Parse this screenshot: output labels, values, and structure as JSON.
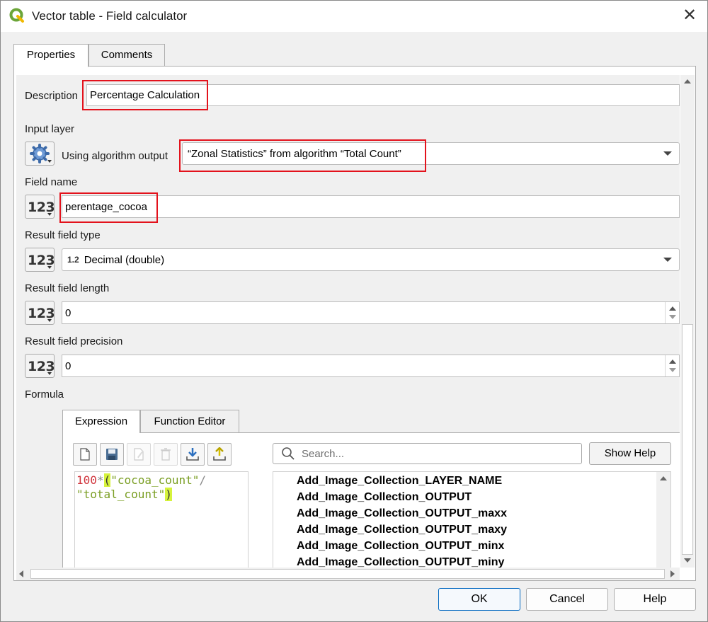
{
  "window": {
    "title": "Vector table - Field calculator",
    "close_glyph": "✕"
  },
  "tabs": [
    {
      "label": "Properties",
      "active": true
    },
    {
      "label": "Comments",
      "active": false
    }
  ],
  "form": {
    "description_label": "Description",
    "description_value": "Percentage Calculation",
    "input_layer_label": "Input layer",
    "input_layer_mode": "Using algorithm output",
    "input_layer_value": "“Zonal Statistics” from algorithm “Total Count”",
    "field_name_label": "Field name",
    "field_name_value": "perentage_cocoa",
    "result_type_label": "Result field type",
    "result_type_prefix": "1.2",
    "result_type_value": "Decimal (double)",
    "result_length_label": "Result field length",
    "result_length_value": "0",
    "result_precision_label": "Result field precision",
    "result_precision_value": "0",
    "formula_label": "Formula",
    "number_button_glyph": "123"
  },
  "formula": {
    "tabs": [
      {
        "label": "Expression",
        "active": true
      },
      {
        "label": "Function Editor",
        "active": false
      }
    ],
    "toolbar": [
      "new-file-icon",
      "save-icon",
      "edit-icon",
      "delete-icon",
      "import-icon",
      "export-icon"
    ],
    "expression": {
      "num": "100",
      "op1": "*",
      "open_paren": "(",
      "str1": "\"cocoa_count\"",
      "op2": "/",
      "str2": "\"total_count\"",
      "close_paren": ")"
    },
    "search_placeholder": "Search...",
    "show_help_label": "Show Help",
    "variables": [
      "Add_Image_Collection_LAYER_NAME",
      "Add_Image_Collection_OUTPUT",
      "Add_Image_Collection_OUTPUT_maxx",
      "Add_Image_Collection_OUTPUT_maxy",
      "Add_Image_Collection_OUTPUT_minx",
      "Add_Image_Collection_OUTPUT_miny"
    ]
  },
  "buttons": {
    "ok": "OK",
    "cancel": "Cancel",
    "help": "Help"
  },
  "colors": {
    "highlight": "#e3121c",
    "accent": "#0067c0",
    "paren_match": "#d6f33c"
  }
}
